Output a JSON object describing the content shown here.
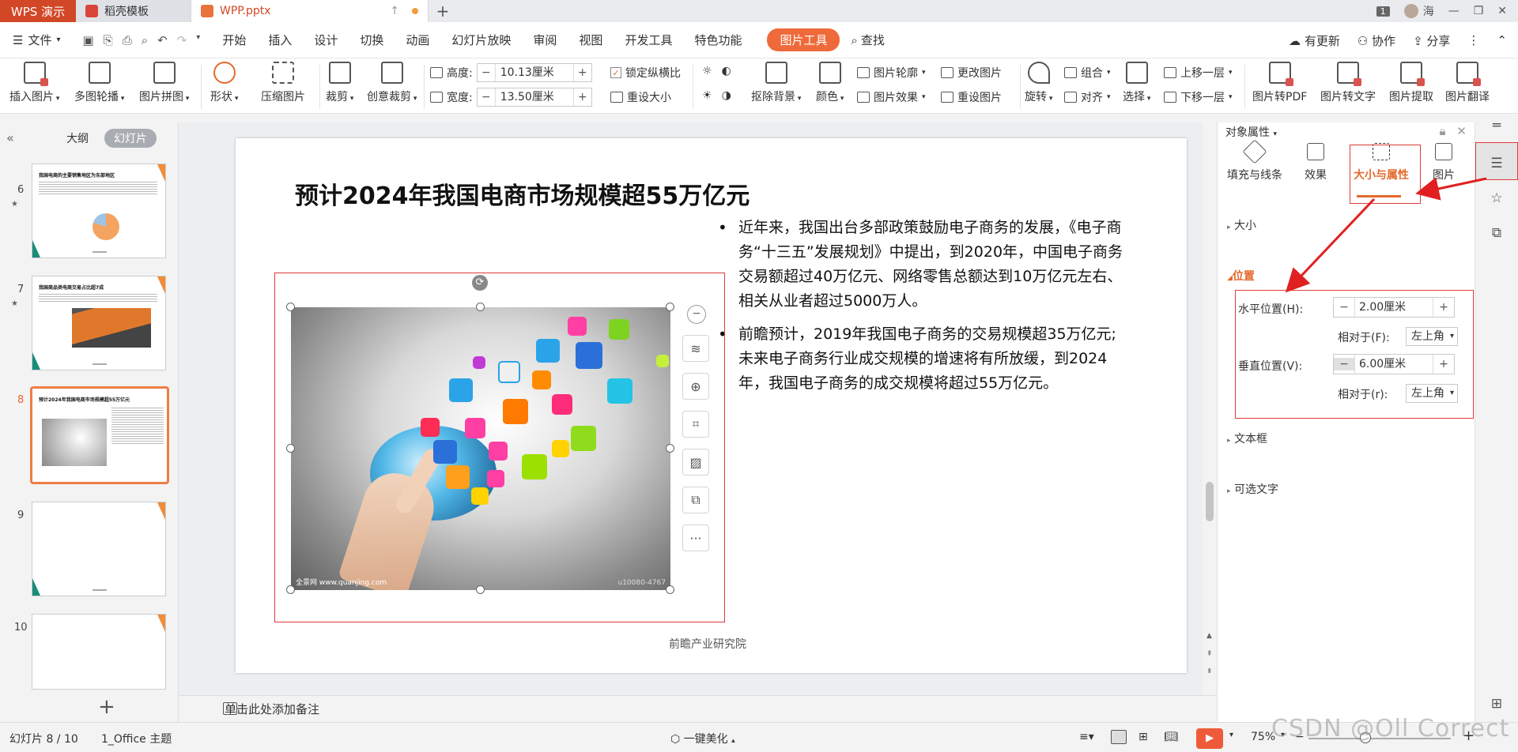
{
  "titlebar": {
    "app_tab": "WPS 演示",
    "tabs": [
      {
        "label": "稻壳模板"
      },
      {
        "label": "WPP.pptx"
      }
    ],
    "window_badge": "1",
    "user": "海"
  },
  "menubar": {
    "file": "文件",
    "items": [
      "开始",
      "插入",
      "设计",
      "切换",
      "动画",
      "幻灯片放映",
      "审阅",
      "视图",
      "开发工具",
      "特色功能"
    ],
    "active_tab": "图片工具",
    "search": "查找",
    "right": [
      "有更新",
      "协作",
      "分享"
    ]
  },
  "ribbon": {
    "insert_picture": "插入图片",
    "carousel": "多图轮播",
    "collage": "图片拼图",
    "shape": "形状",
    "compress": "压缩图片",
    "crop": "裁剪",
    "creative_crop": "创意裁剪",
    "height_label": "高度:",
    "height_value": "10.13厘米",
    "width_label": "宽度:",
    "width_value": "13.50厘米",
    "lock_ratio": "锁定纵横比",
    "reset_size": "重设大小",
    "remove_bg": "抠除背景",
    "color": "颜色",
    "outline": "图片轮廓",
    "effect": "图片效果",
    "change_pic": "更改图片",
    "reset_pic": "重设图片",
    "rotate": "旋转",
    "group": "组合",
    "align": "对齐",
    "select": "选择",
    "bring_forward": "上移一层",
    "send_backward": "下移一层",
    "to_pdf": "图片转PDF",
    "to_text": "图片转文字",
    "extract": "图片提取",
    "translate": "图片翻译"
  },
  "leftpanel": {
    "tab_outline": "大纲",
    "tab_slides": "幻灯片",
    "slides": [
      {
        "num": "6",
        "title": "我国电商的主要销售地区为东部地区"
      },
      {
        "num": "7",
        "title": "我国商品类电商交易占比超7成"
      },
      {
        "num": "8",
        "title": "预计2024年我国电商市场规模超55万亿元"
      },
      {
        "num": "9",
        "title": ""
      },
      {
        "num": "10",
        "title": ""
      }
    ]
  },
  "slide": {
    "title": "预计2024年我国电商市场规模超55万亿元",
    "bullets": [
      "近年来，我国出台多部政策鼓励电子商务的发展，《电子商务“十三五”发展规划》中提出，到2020年，中国电子商务交易额超过40万亿元、网络零售总额达到10万亿元左右、相关从业者超过5000万人。",
      "前瞻预计，2019年我国电子商务的交易规模超35万亿元;未来电子商务行业成交规模的增速将有所放缓，到2024年，我国电子商务的成交规模将超过55万亿元。"
    ],
    "footer": "前瞻产业研究院",
    "image_wm_left": "全景网 www.quanjing.com",
    "image_wm_right": "u10080-4767"
  },
  "notes": {
    "placeholder": "单击此处添加备注"
  },
  "rightpanel": {
    "title": "对象属性",
    "tabs": [
      "填充与线条",
      "效果",
      "大小与属性",
      "图片"
    ],
    "sections": {
      "size": "大小",
      "position": "位置",
      "textbox": "文本框",
      "alt_text": "可选文字"
    },
    "h_pos_label": "水平位置(H):",
    "h_pos_value": "2.00厘米",
    "h_rel_label": "相对于(F):",
    "h_rel_value": "左上角",
    "v_pos_label": "垂直位置(V):",
    "v_pos_value": "6.00厘米",
    "v_rel_label": "相对于(r):",
    "v_rel_value": "左上角"
  },
  "statusbar": {
    "slide_counter": "幻灯片 8 / 10",
    "theme": "1_Office 主题",
    "beautify": "一键美化",
    "zoom": "75%"
  },
  "watermark": "CSDN @Oll Correct",
  "colors": {
    "accent": "#e46a2c",
    "wps_red": "#d24726",
    "highlight": "#e03a3a"
  }
}
